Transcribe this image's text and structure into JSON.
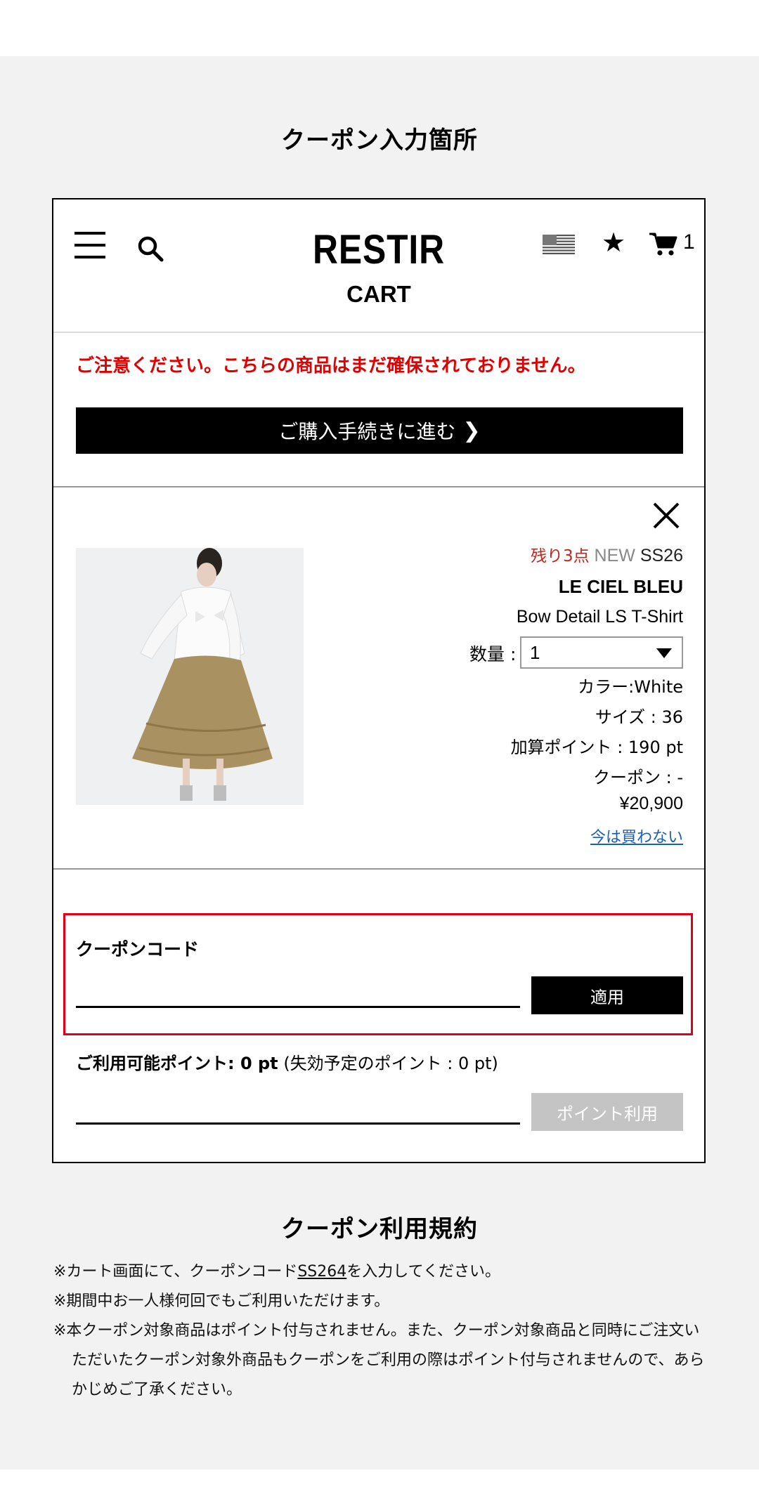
{
  "page": {
    "title": "クーポン入力箇所",
    "terms_title": "クーポン利用規約"
  },
  "header": {
    "logo": "RESTIR",
    "subtitle": "CART",
    "cart_count": "1",
    "icons": [
      "hamburger-menu-icon",
      "search-icon",
      "us-flag-icon",
      "star-icon",
      "cart-icon"
    ]
  },
  "cart": {
    "warning": "ご注意ください。こちらの商品はまだ確保されておりません。",
    "checkout_label": "ご購入手続きに進む",
    "item": {
      "remaining": "残り3点",
      "new_tag": "NEW",
      "season": "SS26",
      "brand": "LE CIEL BLEU",
      "name": "Bow Detail LS T-Shirt",
      "quantity_label": "数量 :",
      "quantity_value": "1",
      "color": "カラー:White",
      "size": "サイズ : 36",
      "points": "加算ポイント : 190 pt",
      "coupon": "クーポン : -",
      "price": "¥20,900",
      "not_buy_link": "今は買わない"
    }
  },
  "coupon": {
    "label": "クーポンコード",
    "input_value": "",
    "apply_label": "適用"
  },
  "points": {
    "available_label": "ご利用可能ポイント: 0 pt",
    "expiring_label": "(失効予定のポイント : 0 pt)",
    "input_value": "",
    "use_label": "ポイント利用"
  },
  "terms": {
    "line1_before": "※カート画面にて、クーポンコード",
    "line1_code": "SS264",
    "line1_after": "を入力してください。",
    "line2": "※期間中お一人様何回でもご利用いただけます。",
    "line3": "※本クーポン対象商品はポイント付与されません。また、クーポン対象商品と同時にご注文いただいたクーポン対象外商品もクーポンをご利用の際はポイント付与されませんので、あらかじめご了承ください。"
  },
  "colors": {
    "warning": "#e00000",
    "coupon_border": "#e0001a",
    "remaining": "#c0261e",
    "link": "#1a5fb4",
    "disabled_button": "#c4c4c4"
  }
}
